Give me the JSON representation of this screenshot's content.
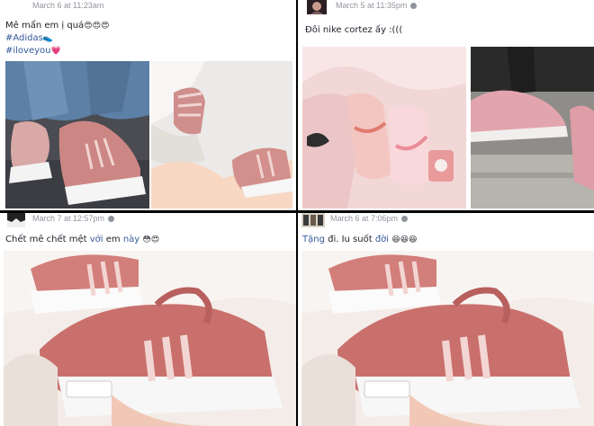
{
  "posts": [
    {
      "timestamp": "March 6 at 11:23am",
      "line1": "Mê mẩn em ị quá",
      "line1_emoji": "😍😍😍",
      "hashtag1": "#Adidas",
      "hashtag1_emoji": "👟",
      "hashtag2": "#iloveyou",
      "hashtag2_emoji": "💗"
    },
    {
      "timestamp": "March 5 at 11:35pm",
      "text": "Đôi nike cortez ấy :((("
    },
    {
      "timestamp": "March 7 at 12:57pm",
      "text_a": "Chết mê chết mệt ",
      "text_hl1": "với",
      "text_b": " em ",
      "text_hl2": "này",
      "text_emoji": "😳😍"
    },
    {
      "timestamp": "March 6 at 7:06pm",
      "text_hl1": "Tặng",
      "text_a": " đi. Iu suốt ",
      "text_hl2": "đời",
      "text_emoji": "😆😆😆"
    }
  ],
  "colors": {
    "link": "#365899",
    "meta": "#90949c",
    "shoe_pink": "#c97b7a",
    "sole_white": "#f4f4f4"
  }
}
